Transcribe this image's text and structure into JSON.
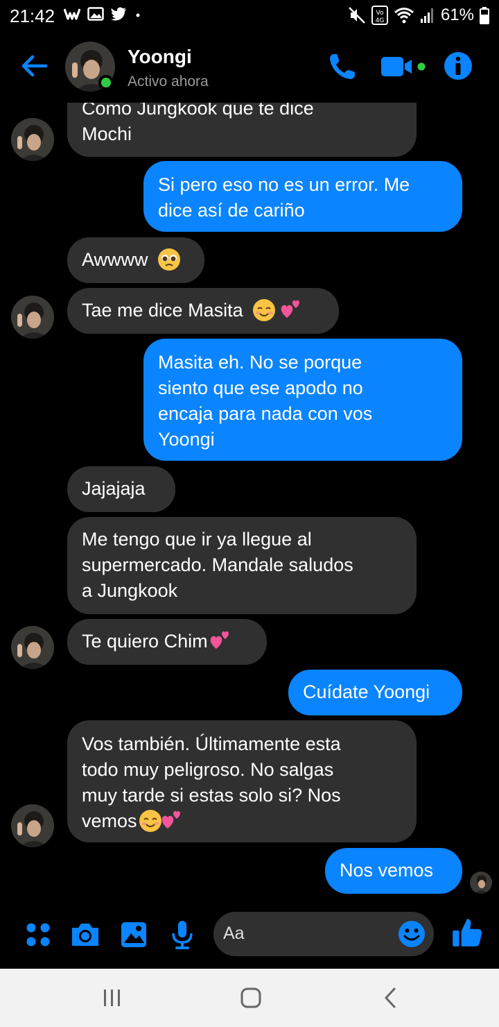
{
  "status_bar": {
    "time": "21:42",
    "battery": "61%",
    "network": "4G"
  },
  "header": {
    "contact_name": "Yoongi",
    "contact_status": "Activo ahora"
  },
  "messages": [
    {
      "direction": "in",
      "lines": [
        "Como Jungkook que te dice",
        "Mochi"
      ]
    },
    {
      "direction": "out",
      "lines": [
        "Si pero eso no es un error. Me",
        "dice así de cariño"
      ]
    },
    {
      "direction": "in",
      "lines": [
        "Awwww"
      ],
      "emoji": "pleading-face"
    },
    {
      "direction": "in",
      "lines": [
        "Tae me dice Masita"
      ],
      "emoji": "smiling-face, two-hearts"
    },
    {
      "direction": "out",
      "lines": [
        "Masita eh. No se porque",
        "siento que ese apodo no",
        "encaja para nada con vos",
        "Yoongi"
      ]
    },
    {
      "direction": "in",
      "lines": [
        "Jajajaja"
      ]
    },
    {
      "direction": "in",
      "lines": [
        "Me tengo que ir ya llegue al",
        "supermercado. Mandale saludos",
        "a Jungkook"
      ]
    },
    {
      "direction": "in",
      "lines": [
        "Te quiero Chim"
      ],
      "emoji": "two-hearts"
    },
    {
      "direction": "out",
      "lines": [
        "Cuídate Yoongi"
      ]
    },
    {
      "direction": "in",
      "lines": [
        "Vos también. Últimamente esta",
        "todo muy peligroso. No salgas",
        "muy tarde si estas solo si? Nos",
        "vemos"
      ],
      "emoji": "smiling-face, two-hearts"
    },
    {
      "direction": "out",
      "lines": [
        "Nos vemos"
      ]
    }
  ],
  "composer": {
    "placeholder": "Aa"
  },
  "colors": {
    "accent": "#0a84ff",
    "incoming_bubble": "#303030",
    "active": "#31cc46",
    "background": "#000000"
  }
}
